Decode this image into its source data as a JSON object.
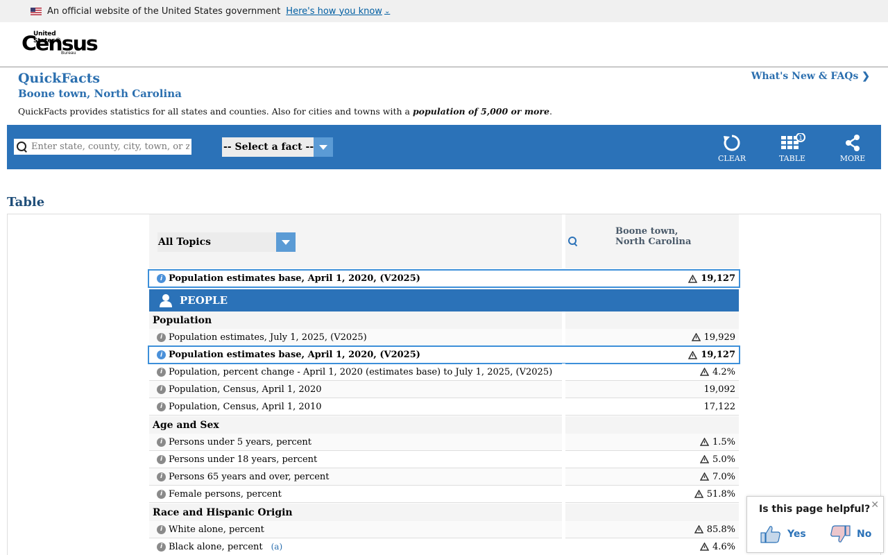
{
  "gov_banner": {
    "text": "An official website of the United States government",
    "link": "Here's how you know"
  },
  "logo": {
    "top": "United States®",
    "main": "Census",
    "bottom": "Bureau"
  },
  "quickfacts": {
    "title": "QuickFacts",
    "location": "Boone town, North Carolina",
    "desc_prefix": "QuickFacts provides statistics for all states and counties. Also for cities and towns with a ",
    "desc_bold": "population of 5,000 or more",
    "desc_suffix": ".",
    "whats_new": "What's New & FAQs"
  },
  "toolbar": {
    "search_placeholder": "Enter state, county, city, town, or zip code",
    "fact_select": "-- Select a fact --",
    "clear": "CLEAR",
    "table": "TABLE",
    "table_badge": "1",
    "more": "MORE"
  },
  "table": {
    "heading": "Table",
    "topic_select": "All Topics",
    "location_header": "Boone town, North Carolina",
    "pinned": {
      "label": "Population estimates base, April 1, 2020, (V2025)",
      "value": "19,127"
    },
    "section": "PEOPLE",
    "groups": {
      "population": "Population",
      "age_sex": "Age and Sex",
      "race": "Race and Hispanic Origin"
    },
    "rows": [
      {
        "label": "Population estimates, July 1, 2025, (V2025)",
        "value": "19,929"
      },
      {
        "label": "Population estimates base, April 1, 2020, (V2025)",
        "value": "19,127"
      },
      {
        "label": "Population, percent change - April 1, 2020 (estimates base) to July 1, 2025, (V2025)",
        "value": "4.2%"
      },
      {
        "label": "Population, Census, April 1, 2020",
        "value": "19,092"
      },
      {
        "label": "Population, Census, April 1, 2010",
        "value": "17,122"
      },
      {
        "label": "Persons under 5 years, percent",
        "value": "1.5%"
      },
      {
        "label": "Persons under 18 years, percent",
        "value": "5.0%"
      },
      {
        "label": "Persons 65 years and over, percent",
        "value": "7.0%"
      },
      {
        "label": "Female persons, percent",
        "value": "51.8%"
      },
      {
        "label": "White alone, percent",
        "value": "85.8%"
      },
      {
        "label": "Black alone, percent",
        "value": "4.6%",
        "footnote": "(a)"
      }
    ]
  },
  "helpful": {
    "question": "Is this page helpful?",
    "yes": "Yes",
    "no": "No"
  },
  "colors": {
    "brand_blue": "#2b72b8",
    "title_blue": "#2b6faf",
    "highlight": "#3c8fd9"
  }
}
